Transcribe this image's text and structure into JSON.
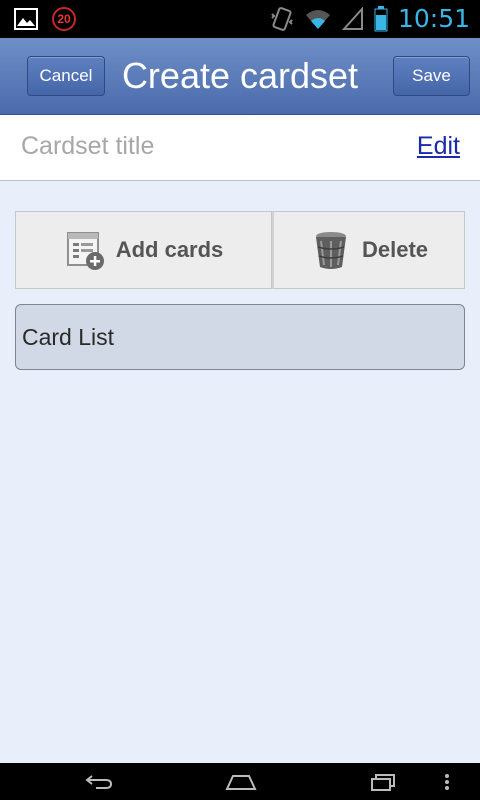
{
  "status_bar": {
    "notification_count": "20",
    "time": "10:51"
  },
  "action_bar": {
    "title": "Create cardset",
    "cancel_label": "Cancel",
    "save_label": "Save"
  },
  "title_row": {
    "placeholder": "Cardset title",
    "edit_label": "Edit"
  },
  "buttons": {
    "add_cards_label": "Add cards",
    "delete_label": "Delete"
  },
  "card_list": {
    "label": "Card List"
  },
  "colors": {
    "accent": "#4a6aab",
    "time": "#39b6e6",
    "link": "#1a2aa8"
  }
}
